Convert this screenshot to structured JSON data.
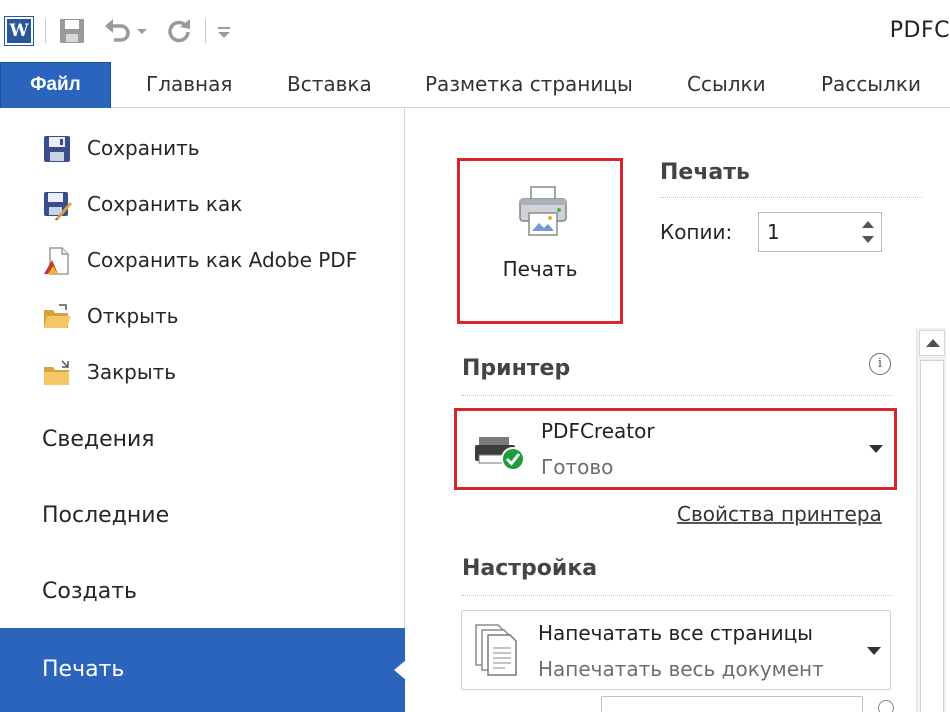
{
  "window": {
    "title": "PDFC"
  },
  "quick_access": {
    "app_logo": "W",
    "icons": [
      "word-logo-icon",
      "save-icon",
      "undo-icon",
      "dropdown-icon",
      "redo-icon",
      "customize-qat-icon"
    ]
  },
  "ribbon": {
    "file_tab": "Файл",
    "tabs": [
      "Главная",
      "Вставка",
      "Разметка страницы",
      "Ссылки",
      "Рассылки"
    ]
  },
  "nav": {
    "commands": [
      {
        "label": "Сохранить",
        "icon": "save-icon"
      },
      {
        "label": "Сохранить как",
        "icon": "save-as-icon"
      },
      {
        "label": "Сохранить как Adobe PDF",
        "icon": "save-as-pdf-icon"
      },
      {
        "label": "Открыть",
        "icon": "open-folder-icon"
      },
      {
        "label": "Закрыть",
        "icon": "close-folder-icon"
      }
    ],
    "sections": [
      "Сведения",
      "Последние",
      "Создать"
    ],
    "active": "Печать"
  },
  "print": {
    "button_label": "Печать",
    "heading": "Печать",
    "copies_label": "Копии:",
    "copies_value": "1"
  },
  "printer": {
    "heading": "Принтер",
    "info_glyph": "i",
    "name": "PDFCreator",
    "status": "Готово",
    "properties_link": "Свойства принтера"
  },
  "settings": {
    "heading": "Настройка",
    "pages_title": "Напечатать все страницы",
    "pages_subtitle": "Напечатать весь документ"
  },
  "colors": {
    "accent": "#2a64bd",
    "highlight": "#d9252d",
    "ready_green": "#1f9d3c"
  }
}
